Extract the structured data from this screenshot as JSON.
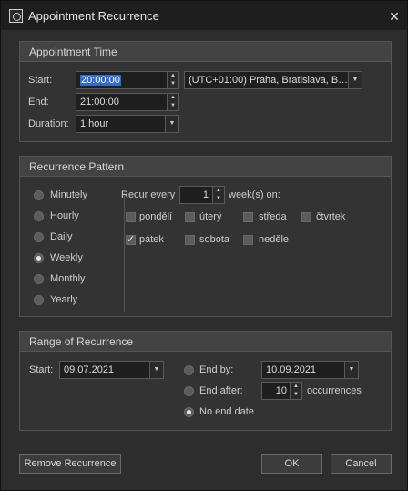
{
  "window": {
    "title": "Appointment Recurrence",
    "close_glyph": "✕"
  },
  "appointment_time": {
    "header": "Appointment Time",
    "start_label": "Start:",
    "start_value": "20:00:00",
    "end_label": "End:",
    "end_value": "21:00:00",
    "duration_label": "Duration:",
    "duration_value": "1 hour",
    "timezone_value": "(UTC+01:00) Praha, Bratislava, B…"
  },
  "recurrence_pattern": {
    "header": "Recurrence Pattern",
    "options": [
      "Minutely",
      "Hourly",
      "Daily",
      "Weekly",
      "Monthly",
      "Yearly"
    ],
    "selected": "Weekly",
    "recur_every_label": "Recur every",
    "recur_every_value": "1",
    "weeks_on_label": "week(s) on:",
    "days": [
      {
        "label": "pondělí",
        "checked": false
      },
      {
        "label": "úterý",
        "checked": false
      },
      {
        "label": "středa",
        "checked": false
      },
      {
        "label": "čtvrtek",
        "checked": false
      },
      {
        "label": "pátek",
        "checked": true
      },
      {
        "label": "sobota",
        "checked": false
      },
      {
        "label": "neděle",
        "checked": false
      }
    ]
  },
  "range": {
    "header": "Range of Recurrence",
    "start_label": "Start:",
    "start_value": "09.07.2021",
    "end_by_label": "End by:",
    "end_by_value": "10.09.2021",
    "end_after_label": "End after:",
    "end_after_value": "10",
    "occurrences_label": "occurrences",
    "no_end_label": "No end date",
    "selected": "No end date"
  },
  "buttons": {
    "remove": "Remove Recurrence",
    "ok": "OK",
    "cancel": "Cancel"
  },
  "colors": {
    "selection": "#2f6bc7",
    "background": "#2d2d2d",
    "header": "#434343"
  }
}
